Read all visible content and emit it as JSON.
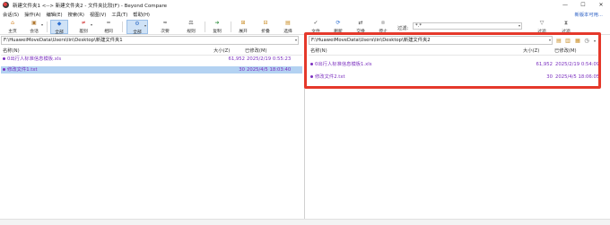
{
  "window": {
    "title": "新建文件夹1 <--> 新建文件夹2 - 文件夹比较(F) - Beyond Compare",
    "minimize": "—",
    "maximize": "☐",
    "close": "✕"
  },
  "menu": {
    "items": [
      "会话(S)",
      "操作(A)",
      "编辑(E)",
      "搜索(R)",
      "视图(V)",
      "工具(T)",
      "帮助(H)"
    ],
    "new_version": "新版本可用..."
  },
  "toolbar": {
    "buttons": [
      {
        "label": "主页",
        "icon": "home-icon",
        "glyph": "⌂",
        "color": "#d08020"
      },
      {
        "label": "会话",
        "icon": "session-icon",
        "glyph": "▣",
        "color": "#b07830"
      },
      {
        "label": "全部",
        "icon": "all-icon",
        "glyph": "◆",
        "color": "#2d6fd0"
      },
      {
        "label": "差别",
        "icon": "diff-icon",
        "glyph": "≠",
        "color": "#d03030"
      },
      {
        "label": "相同",
        "icon": "same-icon",
        "glyph": "=",
        "color": "#555555"
      },
      {
        "label": "全部",
        "icon": "structure-icon",
        "glyph": "⚙",
        "color": "#3b74c9"
      },
      {
        "label": "次要",
        "icon": "minor-icon",
        "glyph": "≈",
        "color": "#444444"
      },
      {
        "label": "规则",
        "icon": "rules-icon",
        "glyph": "⚖",
        "color": "#444444"
      },
      {
        "label": "复制",
        "icon": "copy-icon",
        "glyph": "➔",
        "color": "#2c8c3a"
      },
      {
        "label": "展开",
        "icon": "expand-icon",
        "glyph": "⊞",
        "color": "#c88a20"
      },
      {
        "label": "折叠",
        "icon": "collapse-icon",
        "glyph": "⊟",
        "color": "#c88a20"
      },
      {
        "label": "选择",
        "icon": "select-icon",
        "glyph": "▤",
        "color": "#c88a20"
      },
      {
        "label": "文件",
        "icon": "files-icon",
        "glyph": "✓",
        "color": "#444444"
      },
      {
        "label": "刷新",
        "icon": "refresh-icon",
        "glyph": "⟳",
        "color": "#2d6fd0"
      },
      {
        "label": "交换",
        "icon": "swap-icon",
        "glyph": "⇄",
        "color": "#444444"
      },
      {
        "label": "停止",
        "icon": "stop-icon",
        "glyph": "⊗",
        "color": "#999999"
      },
      {
        "label": "过滤",
        "icon": "filter-icon",
        "glyph": "▽",
        "color": "#666666"
      },
      {
        "label": "过滤",
        "icon": "peek-icon",
        "glyph": "⧗",
        "color": "#666666"
      }
    ],
    "filter_label": "过滤:",
    "filter_value": "*.*"
  },
  "left": {
    "path": "F:\\HuaweiMoveData\\Users\\lin\\Desktop\\新建文件夹1",
    "headers": {
      "name": "名称(N)",
      "size": "大小(Z)",
      "modified": "已修改(M)"
    },
    "rows": [
      {
        "name": "0出行人标准信息模板.xls",
        "size": "61,952",
        "modified": "2025/2/19 0:55:23",
        "selected": false
      },
      {
        "name": "修改文件1.txt",
        "size": "30",
        "modified": "2025/4/5 18:03:40",
        "selected": true
      }
    ]
  },
  "right": {
    "path": "F:\\HuaweiMoveData\\Users\\lin\\Desktop\\新建文件夹2",
    "headers": {
      "name": "名称(N)",
      "size": "大小(Z)",
      "modified": "已修改(M)"
    },
    "rows": [
      {
        "name": "0出行人标准信息模板1.xls",
        "size": "61,952",
        "modified": "2025/2/19 0:54:09",
        "selected": false
      },
      {
        "name": "修改文件2.txt",
        "size": "30",
        "modified": "2025/4/5 18:06:05",
        "selected": false
      }
    ]
  },
  "colors": {
    "orphan_text": "#7b2fbf",
    "selection": "#b3d2f2",
    "highlight_border": "#e5392b"
  }
}
